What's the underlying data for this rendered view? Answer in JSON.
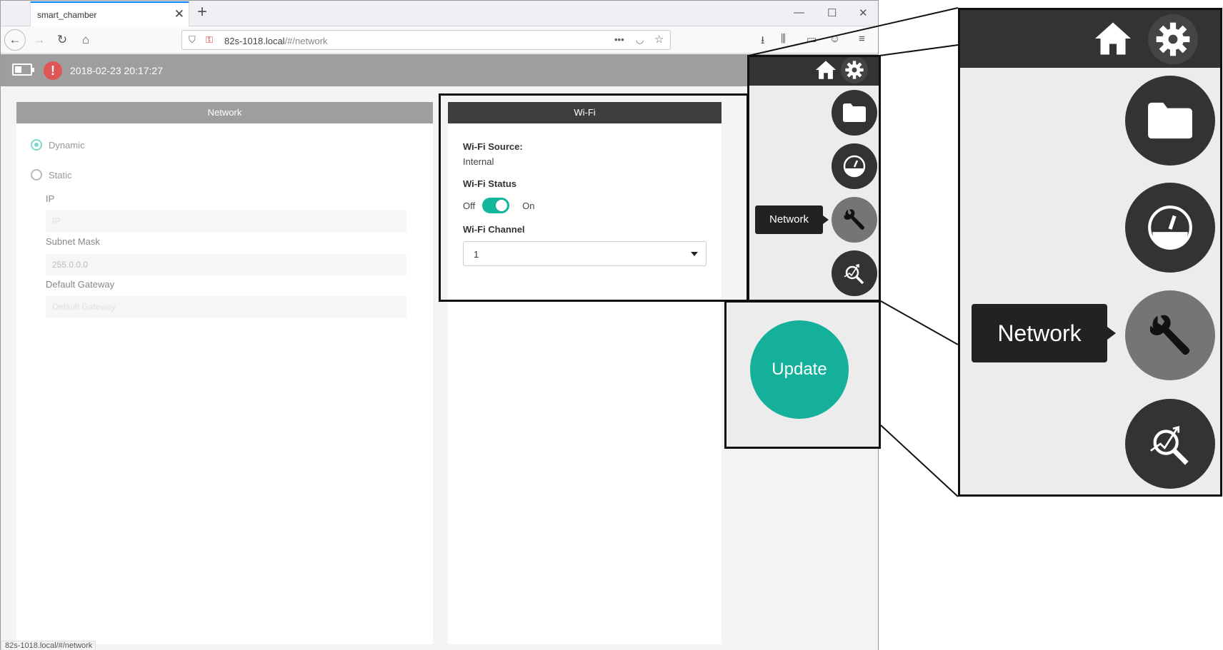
{
  "browser": {
    "tab_title": "smart_chamber",
    "url_host": "82s-1018.local",
    "url_path": "/#/network",
    "status_url": "82s-1018.local/#/network"
  },
  "header": {
    "datetime": "2018-02-23 20:17:27"
  },
  "network": {
    "title": "Network",
    "dynamic_label": "Dynamic",
    "static_label": "Static",
    "selected_mode": "Dynamic",
    "ip_label": "IP",
    "ip_placeholder": "IP",
    "subnet_label": "Subnet Mask",
    "subnet_value": "255.0.0.0",
    "gateway_label": "Default Gateway",
    "gateway_placeholder": "Default Gateway"
  },
  "wifi": {
    "title": "Wi-Fi",
    "source_label": "Wi-Fi Source:",
    "source_value": "Internal",
    "status_label": "Wi-Fi Status",
    "off_label": "Off",
    "on_label": "On",
    "status_on": true,
    "channel_label": "Wi-Fi Channel",
    "channel_value": "1"
  },
  "rail": {
    "tooltip": "Network",
    "items": [
      "folder-icon",
      "gauge-icon",
      "wrench-icon",
      "analysis-icon"
    ],
    "active_item": "wrench-icon"
  },
  "update_label": "Update",
  "zoom": {
    "tooltip": "Network"
  },
  "colors": {
    "header_gray": "#9e9e9e",
    "dark": "#333333",
    "accent_teal": "#14b09a",
    "alert_red": "#e05555"
  }
}
